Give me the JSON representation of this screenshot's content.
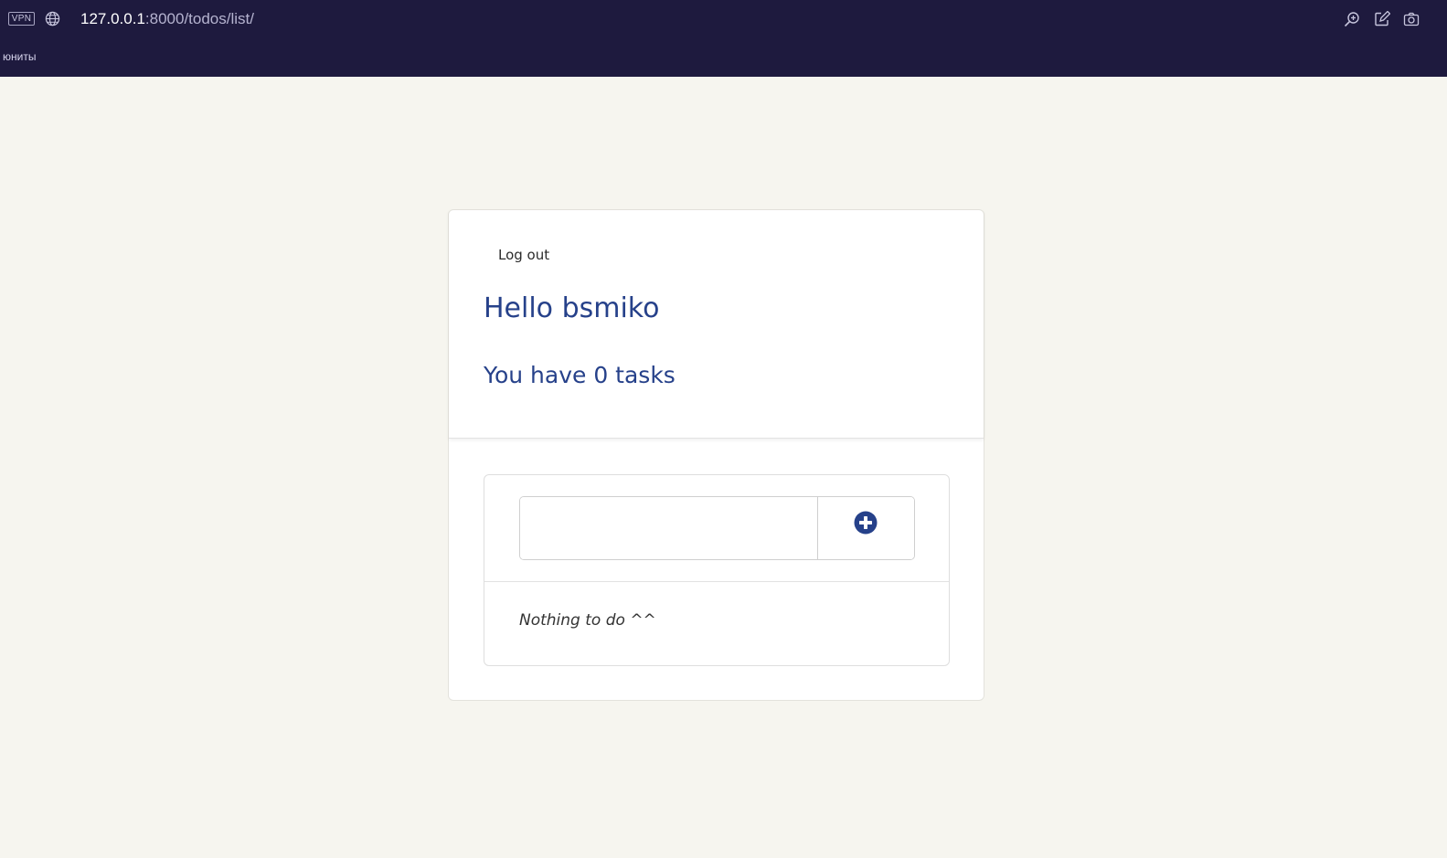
{
  "browser": {
    "vpn_label": "VPN",
    "url_host": "127.0.0.1",
    "url_path": ":8000/todos/list/",
    "bookmarks": [
      {
        "label": "юниты"
      }
    ],
    "toolbar_icons": [
      "zoom-in-icon",
      "edit-page-icon",
      "screenshot-icon"
    ]
  },
  "page": {
    "logout_label": "Log out",
    "greeting": "Hello bsmiko",
    "task_count": "You have 0 tasks",
    "new_task": {
      "value": "",
      "placeholder": ""
    },
    "add_icon": "plus-circle-icon",
    "empty_message": "Nothing to do ^^"
  },
  "colors": {
    "chrome_bg": "#1e1a3e",
    "page_bg": "#f6f5ef",
    "accent": "#26418a"
  }
}
